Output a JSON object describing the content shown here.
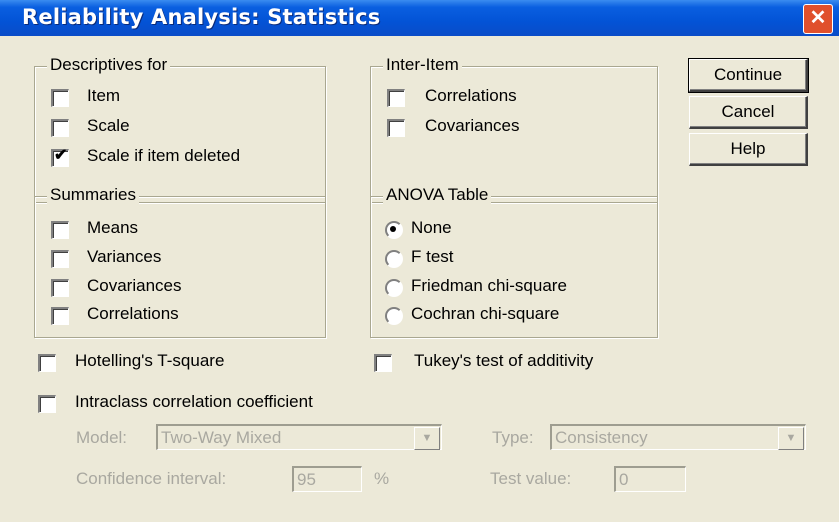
{
  "window": {
    "title": "Reliability Analysis: Statistics",
    "close_glyph": "✕"
  },
  "buttons": {
    "continue": "Continue",
    "cancel": "Cancel",
    "help": "Help"
  },
  "descriptives": {
    "legend": "Descriptives for",
    "items": [
      {
        "label": "Item",
        "checked": false
      },
      {
        "label": "Scale",
        "checked": false
      },
      {
        "label": "Scale if item deleted",
        "checked": true
      }
    ]
  },
  "inter_item": {
    "legend": "Inter-Item",
    "items": [
      {
        "label": "Correlations",
        "checked": false
      },
      {
        "label": "Covariances",
        "checked": false
      }
    ]
  },
  "summaries": {
    "legend": "Summaries",
    "items": [
      {
        "label": "Means",
        "checked": false
      },
      {
        "label": "Variances",
        "checked": false
      },
      {
        "label": "Covariances",
        "checked": false
      },
      {
        "label": "Correlations",
        "checked": false
      }
    ]
  },
  "anova": {
    "legend": "ANOVA Table",
    "items": [
      {
        "label": "None",
        "selected": true
      },
      {
        "label": "F test",
        "selected": false
      },
      {
        "label": "Friedman chi-square",
        "selected": false
      },
      {
        "label": "Cochran chi-square",
        "selected": false
      }
    ]
  },
  "options": {
    "hotelling": {
      "label": "Hotelling's T-square",
      "checked": false
    },
    "tukey": {
      "label": "Tukey's test of additivity",
      "checked": false
    },
    "intraclass": {
      "label": "Intraclass correlation coefficient",
      "checked": false
    }
  },
  "icc": {
    "model_label": "Model:",
    "model_value": "Two-Way Mixed",
    "type_label": "Type:",
    "type_value": "Consistency",
    "ci_label": "Confidence interval:",
    "ci_value": "95",
    "ci_unit": "%",
    "test_label": "Test value:",
    "test_value": "0",
    "dropdown_glyph": "▼"
  },
  "colors": {
    "title_bar": "#0353d6",
    "dialog_bg": "#ece9d8",
    "close_button": "#e0502c",
    "disabled_text": "#a9a8a0"
  }
}
